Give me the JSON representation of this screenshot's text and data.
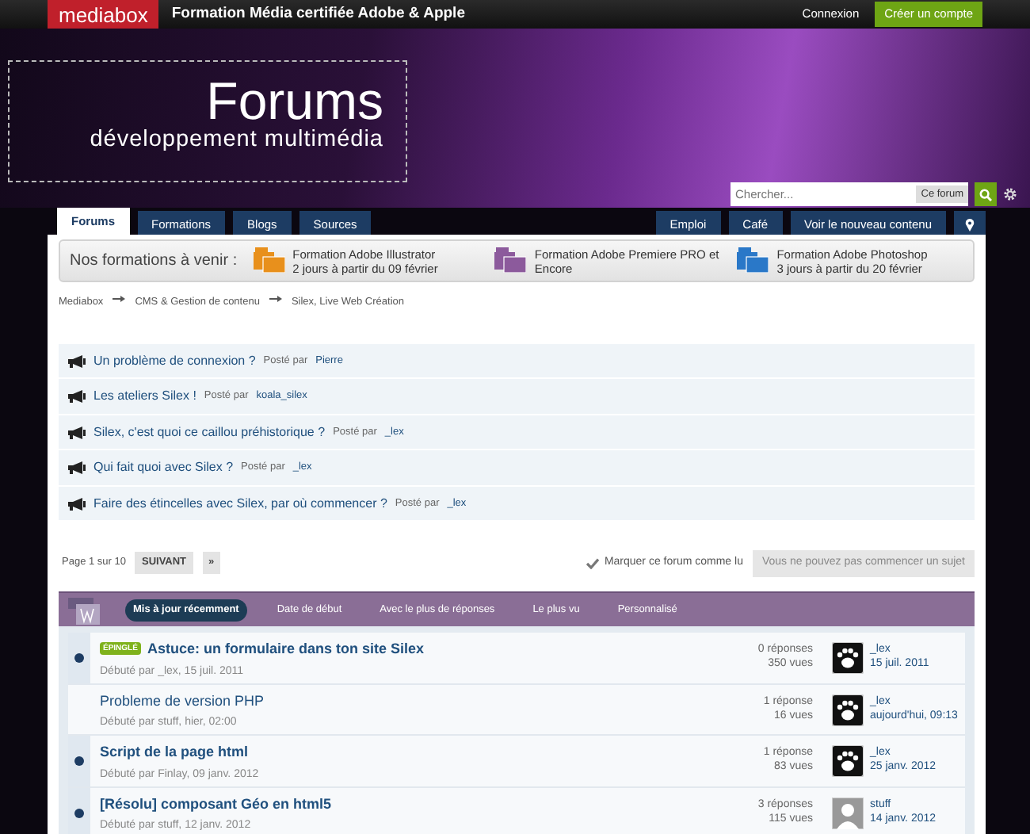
{
  "topbar": {
    "logo": "mediabox",
    "tagline": "Formation Média certifiée Adobe & Apple",
    "login": "Connexion",
    "signup": "Créer un compte"
  },
  "banner": {
    "title": "Forums",
    "subtitle": "développement multimédia"
  },
  "search": {
    "placeholder": "Chercher...",
    "scope": "Ce forum"
  },
  "tabs_left": [
    {
      "label": "Forums",
      "selected": true
    },
    {
      "label": "Formations",
      "selected": false
    },
    {
      "label": "Blogs",
      "selected": false
    },
    {
      "label": "Sources",
      "selected": false
    }
  ],
  "tabs_right": [
    {
      "label": "Emploi",
      "selected": false
    },
    {
      "label": "Café",
      "selected": false
    },
    {
      "label": "Voir le nouveau contenu",
      "selected": false
    }
  ],
  "formations": {
    "label": "Nos formations à venir :",
    "items": [
      {
        "kind": "ai",
        "title": "Formation Adobe Illustrator",
        "date": "2 jours à partir du 09 février"
      },
      {
        "kind": "pr",
        "title": "Formation Adobe Premiere PRO et Encore"
      },
      {
        "kind": "ps",
        "title": "Formation Adobe Photoshop",
        "date": "3 jours à partir du 20 février"
      }
    ]
  },
  "breadcrumb": [
    "Mediabox",
    "CMS & Gestion de contenu",
    "Silex, Live Web Création"
  ],
  "announcements": [
    {
      "title": "Un problème de connexion ?",
      "posted_by": "Posté par",
      "author": "Pierre"
    },
    {
      "title": "Les ateliers Silex !",
      "posted_by": "Posté par",
      "author": "koala_silex"
    },
    {
      "title": "Silex, c'est quoi ce caillou préhistorique ?",
      "posted_by": "Posté par",
      "author": "_lex"
    },
    {
      "title": "Qui fait quoi avec Silex ?",
      "posted_by": "Posté par",
      "author": "_lex"
    },
    {
      "title": "Faire des étincelles avec Silex, par où commencer ?",
      "posted_by": "Posté par",
      "author": "_lex"
    }
  ],
  "pager": {
    "page": "Page 1 sur 10",
    "next": "SUIVANT",
    "last": "»",
    "mark_read": "Marquer ce forum comme lu",
    "cannot_start": "Vous ne pouvez pas commencer un sujet"
  },
  "sort_tabs": [
    {
      "label": "Mis à jour récemment",
      "selected": true
    },
    {
      "label": "Date de début",
      "selected": false
    },
    {
      "label": "Avec le plus de réponses",
      "selected": false
    },
    {
      "label": "Le plus vu",
      "selected": false
    },
    {
      "label": "Personnalisé",
      "selected": false
    }
  ],
  "topics": [
    {
      "unread": true,
      "badge": "ÉPINGLÉ",
      "title": "Astuce: un formulaire dans ton site Silex",
      "started": "Débuté par _lex, 15 juil. 2011",
      "replies": "0 réponses",
      "views": "350 vues",
      "avatar": {
        "kind": "paw"
      },
      "last_author": "_lex",
      "last_date": "15 juil. 2011"
    },
    {
      "unread": false,
      "title": "Probleme de version PHP",
      "started": "Débuté par stuff, hier, 02:00",
      "replies": "1 réponse",
      "views": "16 vues",
      "avatar": {
        "kind": "paw"
      },
      "last_author": "_lex",
      "last_date": "aujourd'hui, 09:13"
    },
    {
      "unread": true,
      "title": "Script de la page html",
      "started": "Débuté par Finlay, 09 janv. 2012",
      "replies": "1 réponse",
      "views": "83 vues",
      "avatar": {
        "kind": "paw"
      },
      "last_author": "_lex",
      "last_date": "25 janv. 2012"
    },
    {
      "unread": true,
      "title": "[Résolu] composant Géo en html5",
      "started": "Débuté par stuff, 12 janv. 2012",
      "replies": "3 réponses",
      "views": "115 vues",
      "avatar": {
        "kind": "person"
      },
      "last_author": "stuff",
      "last_date": "14 janv. 2012"
    }
  ]
}
